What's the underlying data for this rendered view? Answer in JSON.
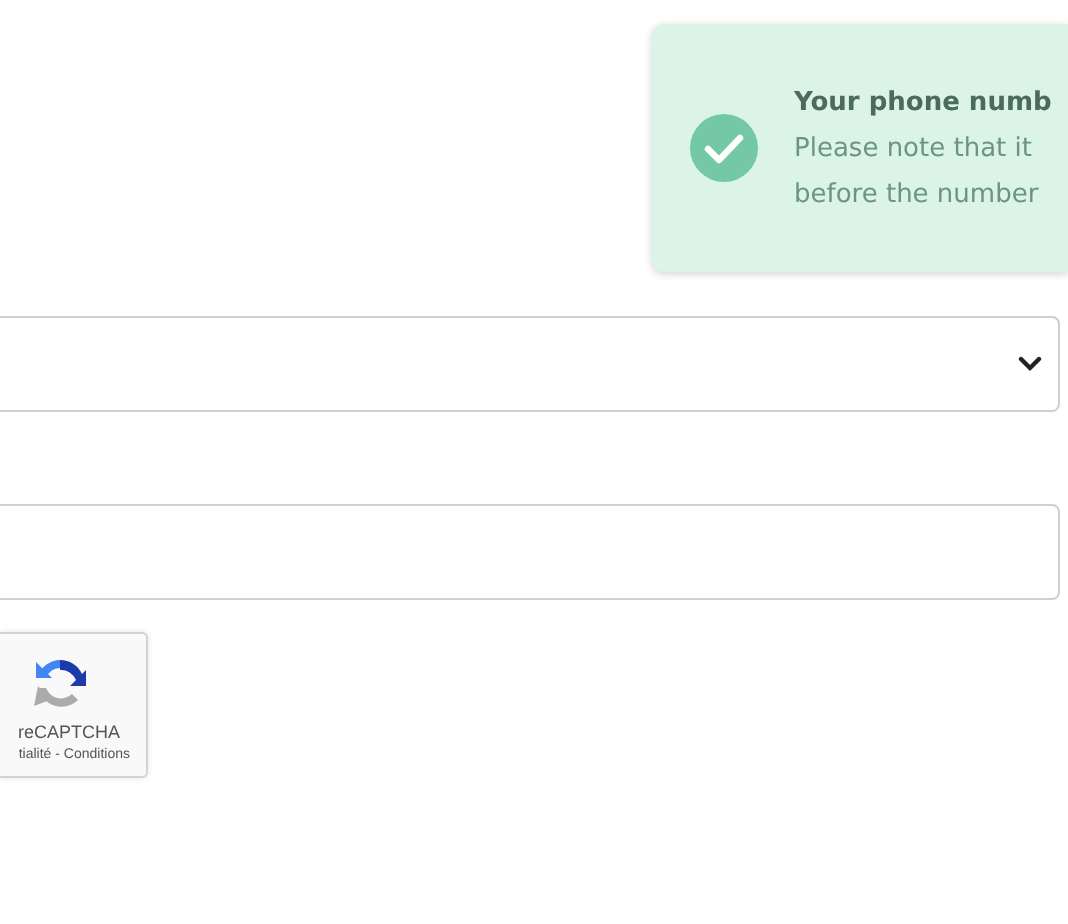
{
  "notification": {
    "kind": "success",
    "title": "Your phone numb",
    "lines": [
      "Please note that it",
      "before the number"
    ]
  },
  "recaptcha": {
    "label": "reCAPTCHA",
    "links": "tialité - Conditions"
  }
}
